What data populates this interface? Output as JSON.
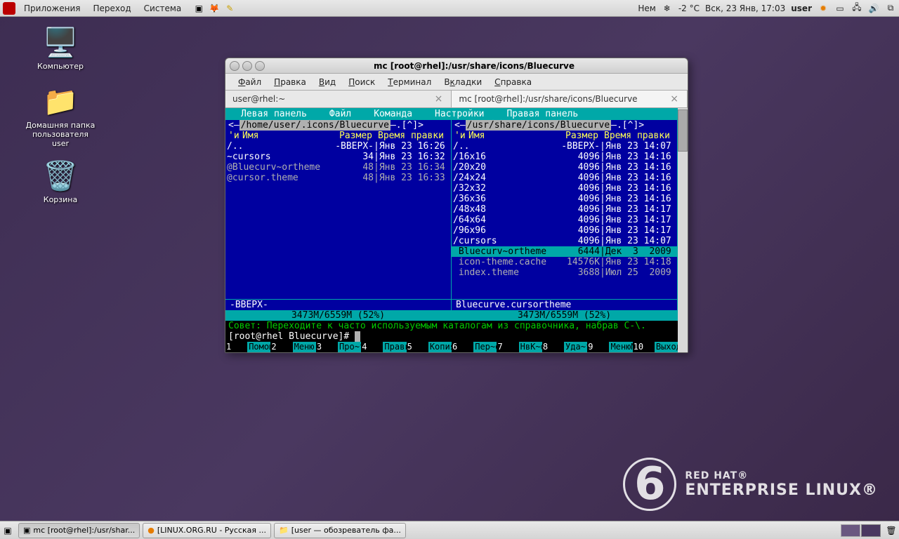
{
  "panel": {
    "menu": [
      "Приложения",
      "Переход",
      "Система"
    ],
    "weather_loc": "Нем",
    "weather_temp": "-2 °C",
    "datetime": "Вск, 23 Янв, 17:03",
    "user": "user"
  },
  "desktop": {
    "computer": "Компьютер",
    "home": "Домашняя папка пользователя user",
    "trash": "Корзина"
  },
  "rhel": {
    "six": "6",
    "l1": "RED HAT®",
    "l2": "ENTERPRISE LINUX®"
  },
  "taskbar": {
    "t1": "mc [root@rhel]:/usr/shar...",
    "t2": "[LINUX.ORG.RU - Русская ...",
    "t3": "[user — обозреватель фа..."
  },
  "win": {
    "title": "mc [root@rhel]:/usr/share/icons/Bluecurve",
    "menu": [
      "Файл",
      "Правка",
      "Вид",
      "Поиск",
      "Терминал",
      "Вкладки",
      "Справка"
    ],
    "tab1": "user@rhel:~",
    "tab2": "mc [root@rhel]:/usr/share/icons/Bluecurve"
  },
  "mc": {
    "menu": [
      "Левая панель",
      "Файл",
      "Команда",
      "Настройки",
      "Правая панель"
    ],
    "left": {
      "path_pre": "<— ",
      "path": "/home/user/.icons/Bluecurve",
      "path_post": " —.[^]>",
      "hdr_mark": "'и",
      "hdr_name": "Имя",
      "hdr_size": "Размер",
      "hdr_time": "Время правки",
      "rows": [
        {
          "n": "/..",
          "s": "-ВВЕРХ-",
          "t": "Янв 23 16:26",
          "cls": "dir"
        },
        {
          "n": "~cursors",
          "s": "34",
          "t": "Янв 23 16:32",
          "cls": "dir"
        },
        {
          "n": "@Bluecurv~ortheme",
          "s": "48",
          "t": "Янв 23 16:34",
          "cls": "exec"
        },
        {
          "n": "@cursor.theme",
          "s": "48",
          "t": "Янв 23 16:33",
          "cls": "exec"
        }
      ],
      "mini": "-ВВЕРХ-",
      "bar": "3473M/6559M (52%)"
    },
    "right": {
      "path_pre": "<— ",
      "path": "/usr/share/icons/Bluecurve",
      "path_post": " —.[^]>",
      "hdr_mark": "'и",
      "hdr_name": "Имя",
      "hdr_size": "Размер",
      "hdr_time": "Время правки",
      "rows": [
        {
          "n": "/..",
          "s": "-ВВЕРХ-",
          "t": "Янв 23 14:07",
          "cls": "dir"
        },
        {
          "n": "/16x16",
          "s": "4096",
          "t": "Янв 23 14:16",
          "cls": "dir"
        },
        {
          "n": "/20x20",
          "s": "4096",
          "t": "Янв 23 14:16",
          "cls": "dir"
        },
        {
          "n": "/24x24",
          "s": "4096",
          "t": "Янв 23 14:16",
          "cls": "dir"
        },
        {
          "n": "/32x32",
          "s": "4096",
          "t": "Янв 23 14:16",
          "cls": "dir"
        },
        {
          "n": "/36x36",
          "s": "4096",
          "t": "Янв 23 14:16",
          "cls": "dir"
        },
        {
          "n": "/48x48",
          "s": "4096",
          "t": "Янв 23 14:17",
          "cls": "dir"
        },
        {
          "n": "/64x64",
          "s": "4096",
          "t": "Янв 23 14:17",
          "cls": "dir"
        },
        {
          "n": "/96x96",
          "s": "4096",
          "t": "Янв 23 14:17",
          "cls": "dir"
        },
        {
          "n": "/cursors",
          "s": "4096",
          "t": "Янв 23 14:07",
          "cls": "dir"
        },
        {
          "n": " Bluecurv~ortheme",
          "s": "6444",
          "t": "Дек  3  2009",
          "cls": "sel"
        },
        {
          "n": " icon-theme.cache",
          "s": "14576K",
          "t": "Янв 23 14:18",
          "cls": "exec"
        },
        {
          "n": " index.theme",
          "s": "3688",
          "t": "Июл 25  2009",
          "cls": "exec"
        }
      ],
      "mini": "Bluecurve.cursortheme",
      "bar": "3473M/6559M (52%)"
    },
    "tip": "Совет: Переходите к часто используемым каталогам из справочника, набрав C-\\.",
    "prompt": "[root@rhel Bluecurve]# ",
    "fn": [
      {
        "n": "1",
        "l": "Помощь"
      },
      {
        "n": "2",
        "l": "Меню"
      },
      {
        "n": "3",
        "l": "Про~тр"
      },
      {
        "n": "4",
        "l": "Правка"
      },
      {
        "n": "5",
        "l": "Копия"
      },
      {
        "n": "6",
        "l": "Пер~ос"
      },
      {
        "n": "7",
        "l": "НвК~ог"
      },
      {
        "n": "8",
        "l": "Уда~ть"
      },
      {
        "n": "9",
        "l": "МенюМС"
      },
      {
        "n": "10",
        "l": "Выход"
      }
    ]
  }
}
